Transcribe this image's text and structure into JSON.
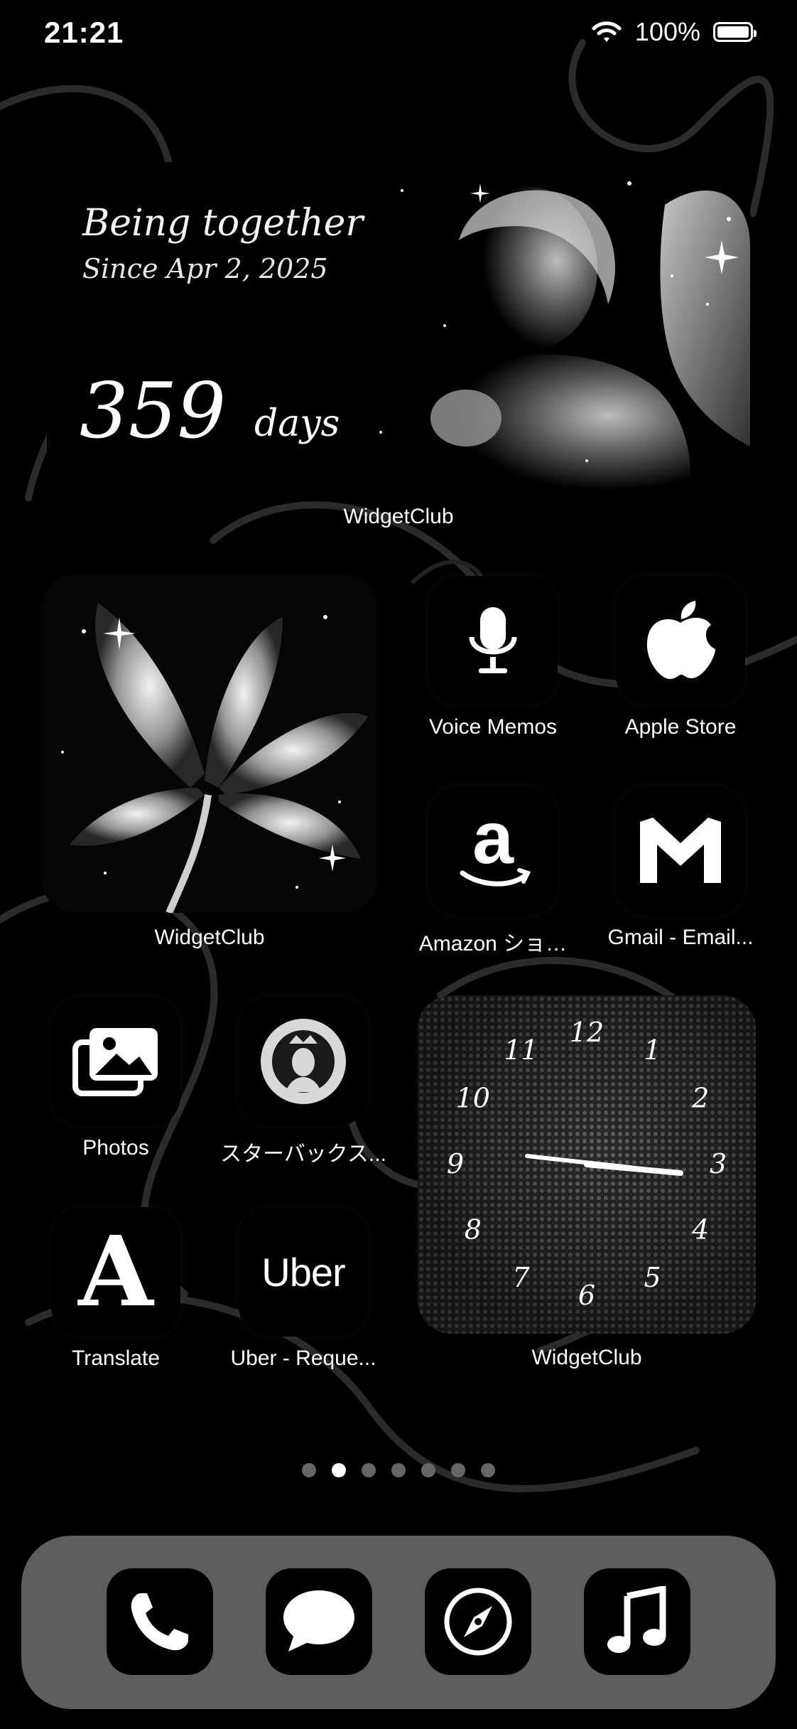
{
  "status_bar": {
    "time": "21:21",
    "battery": "100%"
  },
  "widgets": {
    "couple": {
      "title": "Being together",
      "since": "Since Apr 2, 2025",
      "days_number": "359",
      "days_unit": "days",
      "label": "WidgetClub"
    },
    "lily": {
      "label": "WidgetClub"
    },
    "clock": {
      "label": "WidgetClub",
      "numerals": [
        "12",
        "1",
        "2",
        "3",
        "4",
        "5",
        "6",
        "7",
        "8",
        "9",
        "10",
        "11"
      ]
    }
  },
  "apps": [
    {
      "label": "Voice Memos",
      "icon": "microphone-icon"
    },
    {
      "label": "Apple Store",
      "icon": "apple-icon"
    },
    {
      "label": "Amazon ショ…",
      "icon": "amazon-icon"
    },
    {
      "label": "Gmail - Email...",
      "icon": "gmail-icon"
    },
    {
      "label": "Photos",
      "icon": "photos-icon"
    },
    {
      "label": "スターバックス...",
      "icon": "starbucks-icon"
    },
    {
      "label": "Translate",
      "icon": "translate-icon"
    },
    {
      "label": "Uber - Reque...",
      "icon": "uber-icon",
      "icon_text": "Uber"
    }
  ],
  "page_indicator": {
    "count": 7,
    "active_index": 1
  },
  "dock": [
    {
      "icon": "phone-icon"
    },
    {
      "icon": "messages-icon"
    },
    {
      "icon": "safari-compass-icon"
    },
    {
      "icon": "music-note-icon"
    }
  ]
}
